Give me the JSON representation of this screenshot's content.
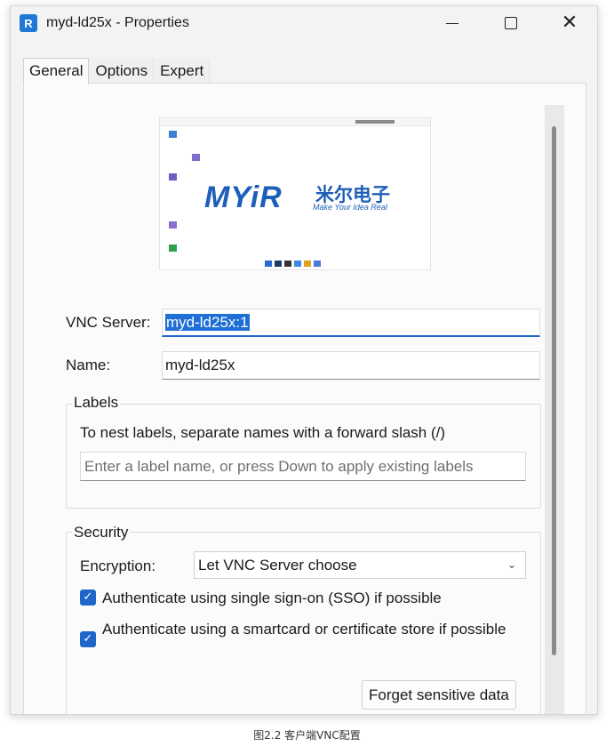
{
  "window": {
    "title": "myd-ld25x - Properties",
    "app_icon_glyph": "R",
    "controls": {
      "minimize_icon": "minimize-icon",
      "maximize_icon": "maximize-icon",
      "close_icon": "close-icon",
      "close_glyph": "✕"
    }
  },
  "tabs": [
    {
      "label": "General",
      "active": true
    },
    {
      "label": "Options",
      "active": false
    },
    {
      "label": "Expert",
      "active": false
    }
  ],
  "preview": {
    "logo_text": "MYiR",
    "logo_cn": "米尔电子",
    "tagline": "Make Your Idea Real"
  },
  "vnc_server": {
    "label": "VNC Server:",
    "value": "myd-ld25x:1"
  },
  "name": {
    "label": "Name:",
    "value": "myd-ld25x"
  },
  "labels_group": {
    "title": "Labels",
    "hint": "To nest labels, separate names with a forward slash (/)",
    "placeholder": "Enter a label name, or press Down to apply existing labels"
  },
  "security": {
    "title": "Security",
    "encryption_label": "Encryption:",
    "encryption_value": "Let VNC Server choose",
    "checkboxes": [
      {
        "label": "Authenticate using single sign-on (SSO) if possible",
        "checked": true
      },
      {
        "label": "Authenticate using a smartcard or certificate store if possible",
        "checked": true
      }
    ],
    "forget_button": "Forget sensitive data"
  },
  "caption": "图2.2 客户端VNC配置",
  "colors": {
    "accent": "#1e66c8",
    "selection": "#1e6fd6",
    "logo_blue": "#1d5fb8"
  }
}
